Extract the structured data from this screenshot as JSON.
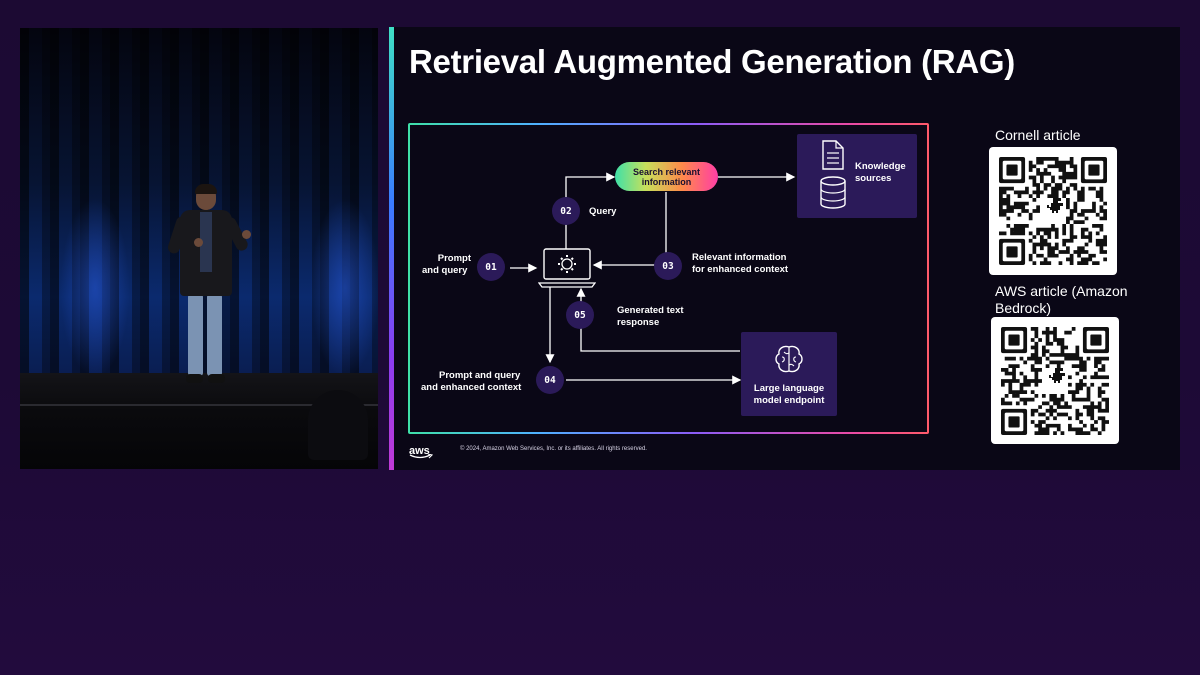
{
  "slide": {
    "title": "Retrieval Augmented Generation (RAG)",
    "copyright": "© 2024, Amazon Web Services, Inc. or its affiliates. All rights reserved.",
    "logo_text": "aws"
  },
  "diagram": {
    "search_line1": "Search relevant",
    "search_line2": "information",
    "knowledge_line1": "Knowledge",
    "knowledge_line2": "sources",
    "prompt_line1": "Prompt",
    "prompt_line2": "and query",
    "step01": "01",
    "step02": "02",
    "step03": "03",
    "step04": "04",
    "step05": "05",
    "query_label": "Query",
    "relevant_line1": "Relevant information",
    "relevant_line2": "for enhanced context",
    "generated_line1": "Generated text",
    "generated_line2": "response",
    "prompt_enh_line1": "Prompt and query",
    "prompt_enh_line2": "and enhanced context",
    "llm_line1": "Large language",
    "llm_line2": "model endpoint"
  },
  "qr_codes": {
    "cornell_label": "Cornell article",
    "aws_label_line1": "AWS article (Amazon",
    "aws_label_line2": "Bedrock)"
  },
  "icons": {
    "document": "document-icon",
    "database": "database-icon",
    "laptop": "laptop-gear-icon",
    "brain": "brain-icon",
    "qr_center": "dinosaur-icon"
  }
}
